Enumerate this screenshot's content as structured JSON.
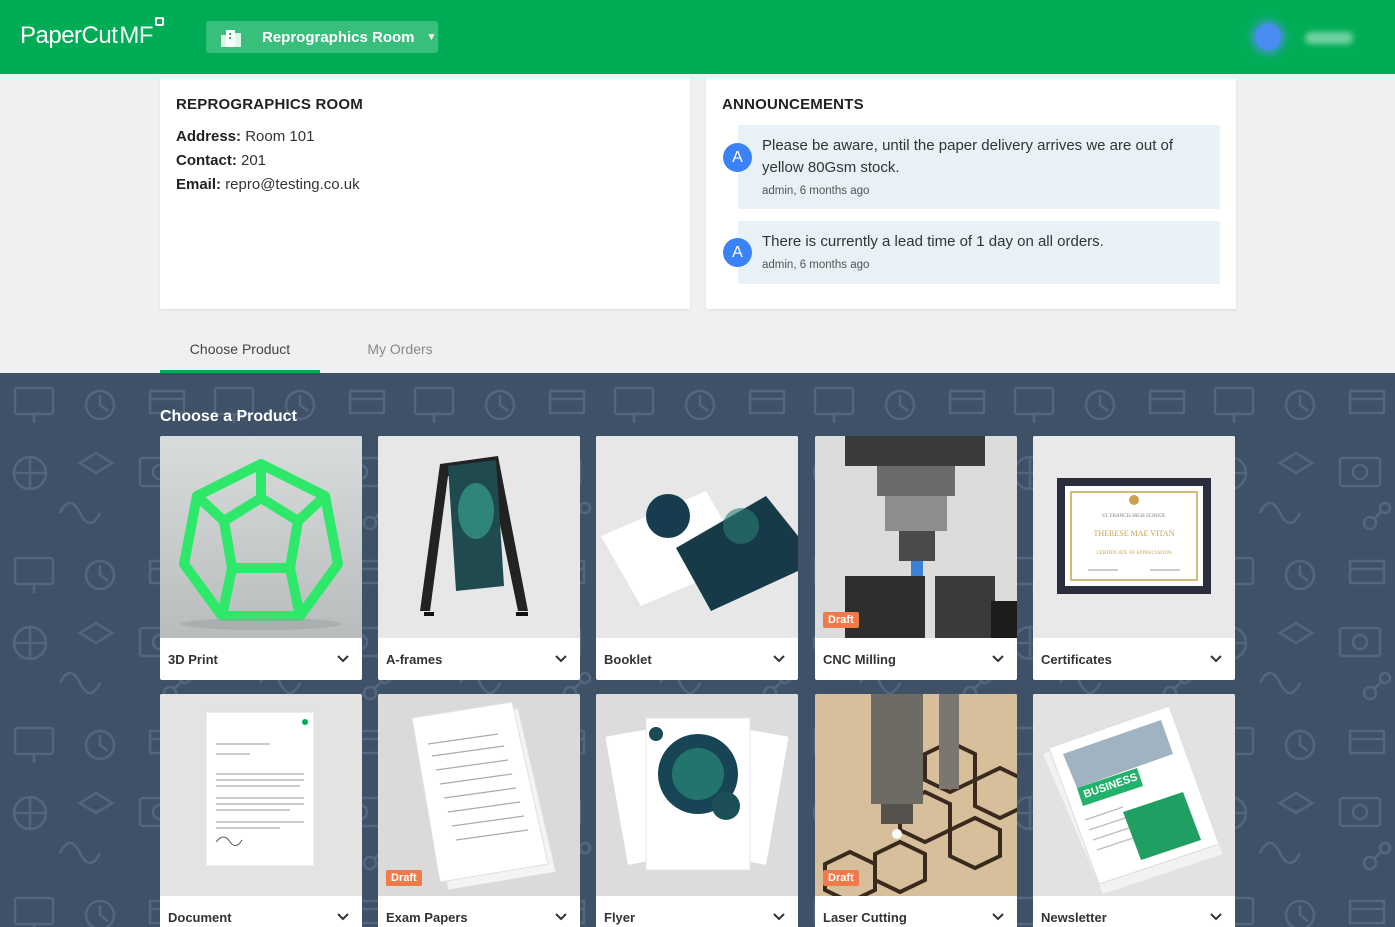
{
  "header": {
    "logo_text": "PaperCut",
    "logo_suffix": "MF",
    "location_label": "Reprographics Room",
    "brand_color": "#00ad56"
  },
  "location_card": {
    "title": "REPROGRAPHICS ROOM",
    "address_label": "Address:",
    "address_value": "Room 101",
    "contact_label": "Contact:",
    "contact_value": "201",
    "email_label": "Email:",
    "email_value": "repro@testing.co.uk"
  },
  "announcements": {
    "title": "ANNOUNCEMENTS",
    "items": [
      {
        "avatar": "A",
        "text": "Please be aware, until the paper delivery arrives we are out of yellow 80Gsm stock.",
        "meta": "admin, 6 months ago"
      },
      {
        "avatar": "A",
        "text": "There is currently a lead time of 1 day on all orders.",
        "meta": "admin, 6 months ago"
      }
    ]
  },
  "tabs": [
    {
      "label": "Choose Product",
      "active": true
    },
    {
      "label": "My Orders",
      "active": false
    }
  ],
  "products_section": {
    "title": "Choose a Product",
    "draft_label": "Draft",
    "items": [
      {
        "name": "3D Print",
        "draft": false,
        "icon": "dodecahedron-image"
      },
      {
        "name": "A-frames",
        "draft": false,
        "icon": "a-frame-sign-image"
      },
      {
        "name": "Booklet",
        "draft": false,
        "icon": "booklet-image"
      },
      {
        "name": "CNC Milling",
        "draft": true,
        "icon": "cnc-drill-image"
      },
      {
        "name": "Certificates",
        "draft": false,
        "icon": "certificate-image"
      },
      {
        "name": "Document",
        "draft": false,
        "icon": "document-image"
      },
      {
        "name": "Exam Papers",
        "draft": true,
        "icon": "paper-stack-image"
      },
      {
        "name": "Flyer",
        "draft": false,
        "icon": "flyer-image"
      },
      {
        "name": "Laser Cutting",
        "draft": true,
        "icon": "laser-cutter-image"
      },
      {
        "name": "Newsletter",
        "draft": false,
        "icon": "newsletter-image"
      }
    ]
  },
  "certificate_image_text": {
    "school": "ST. FRANCIS HIGH SCHOOL",
    "recipient": "THERESE MAE VITAN",
    "caption": "CERTIFICATE OF APPRECIATION"
  },
  "newsletter_image_text": {
    "headline": "BUSINESS"
  }
}
